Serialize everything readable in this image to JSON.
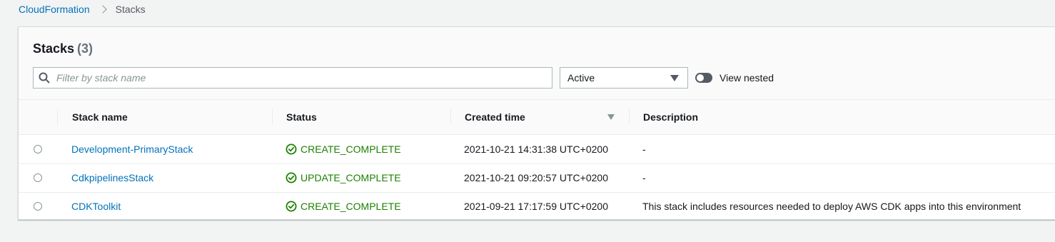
{
  "breadcrumb": {
    "root": "CloudFormation",
    "current": "Stacks"
  },
  "panel": {
    "title": "Stacks",
    "count": "(3)",
    "filter_placeholder": "Filter by stack name",
    "status_filter": "Active",
    "toggle_label": "View nested"
  },
  "columns": {
    "name": "Stack name",
    "status": "Status",
    "created": "Created time",
    "description": "Description"
  },
  "rows": [
    {
      "name": "Development-PrimaryStack",
      "status": "CREATE_COMPLETE",
      "created": "2021-10-21 14:31:38 UTC+0200",
      "description": "-"
    },
    {
      "name": "CdkpipelinesStack",
      "status": "UPDATE_COMPLETE",
      "created": "2021-10-21 09:20:57 UTC+0200",
      "description": "-"
    },
    {
      "name": "CDKToolkit",
      "status": "CREATE_COMPLETE",
      "created": "2021-09-21 17:17:59 UTC+0200",
      "description": "This stack includes resources needed to deploy AWS CDK apps into this environment"
    }
  ],
  "colors": {
    "link": "#0073bb",
    "success": "#1d8102",
    "background": "#f2f3f3"
  },
  "icons": {
    "search": "search-icon",
    "status": "check-circle-icon",
    "sort": "sort-descending-icon",
    "dropdown": "caret-down-icon"
  }
}
